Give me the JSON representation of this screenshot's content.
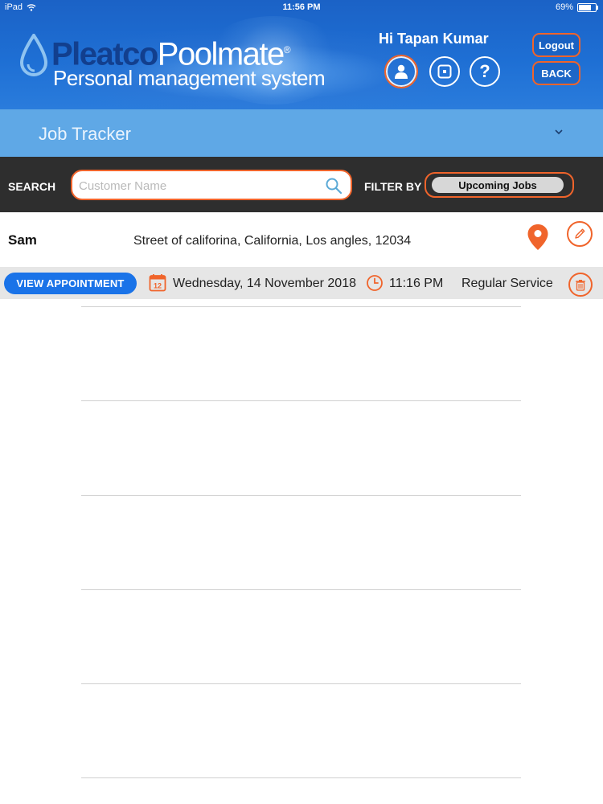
{
  "status_bar": {
    "device": "iPad",
    "time": "11:56 PM",
    "battery": "69%",
    "battery_level": 0.69
  },
  "header": {
    "logo_part1": "Pleatco",
    "logo_part2": "Poolmate",
    "logo_registered": "®",
    "logo_subtitle": "Personal management system",
    "greeting": "Hi Tapan Kumar",
    "icons": [
      "user-icon",
      "box-icon",
      "help-icon"
    ],
    "help_glyph": "?",
    "logout_label": "Logout",
    "back_label": "BACK"
  },
  "title_bar": {
    "title": "Job Tracker",
    "chevron": "chevron-down-icon"
  },
  "search": {
    "label": "SEARCH",
    "placeholder": "Customer Name",
    "value": "",
    "filter_label": "FILTER BY",
    "filter_value": "Upcoming Jobs"
  },
  "jobs": [
    {
      "name": "Sam",
      "address": "Street of califorina, California, Los angles, 12034",
      "view_label": "VIEW APPOINTMENT",
      "calendar_day": "12",
      "date": "Wednesday, 14 November 2018",
      "time": "11:16 PM",
      "service": "Regular Service"
    }
  ],
  "colors": {
    "accent": "#f0642b",
    "header_blue": "#1e6fd4",
    "title_bar": "#5fa8e6",
    "search_bar": "#2e2e2e",
    "button_blue": "#1a73e8"
  }
}
